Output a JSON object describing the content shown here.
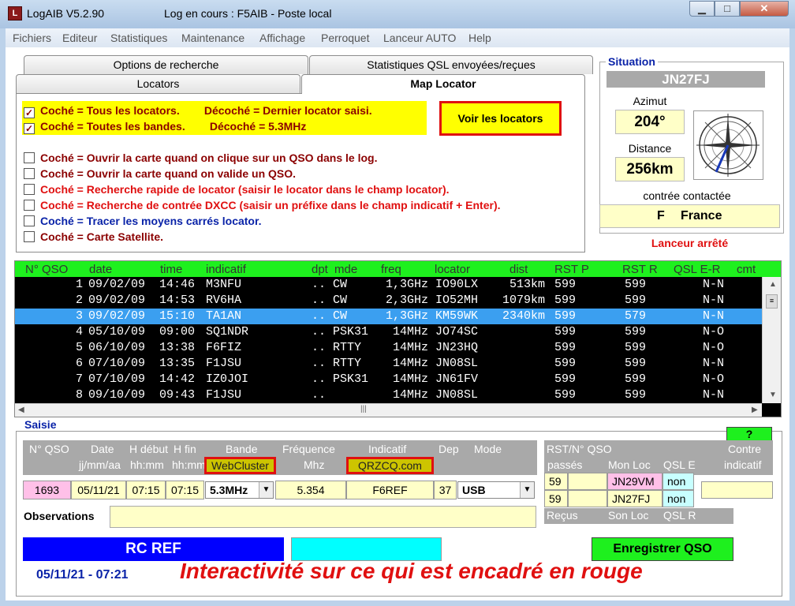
{
  "window": {
    "app_title": "LogAIB  V5.2.90",
    "log_status": "Log en cours : F5AIB - Poste local",
    "min": "▁",
    "max": "□",
    "close": "✕"
  },
  "menu": [
    "Fichiers",
    "Editeur",
    "Statistiques",
    "Maintenance",
    "Affichage",
    "Perroquet",
    "Lanceur AUTO",
    "Help"
  ],
  "tabs": {
    "back_left": "Options de recherche",
    "back_right": "Statistiques QSL envoyées/reçues",
    "front_left": "Locators",
    "active": "Map Locator"
  },
  "map_options": [
    {
      "checked": true,
      "text": "Coché = Tous les locators.        Décoché = Dernier locator saisi.",
      "color": "dark"
    },
    {
      "checked": true,
      "text": "Coché = Toutes les bandes.        Décoché = 5.3MHz",
      "color": "dark"
    },
    {
      "checked": false,
      "text": "Coché = Ouvrir la carte quand on clique sur un QSO dans le log.",
      "color": "dark"
    },
    {
      "checked": false,
      "text": "Coché = Ouvrir la carte quand on valide un QSO.",
      "color": "dark"
    },
    {
      "checked": false,
      "text": "Coché = Recherche rapide de locator (saisir le locator dans le champ locator).",
      "color": "red"
    },
    {
      "checked": false,
      "text": "Coché = Recherche de contrée DXCC (saisir un préfixe dans le champ indicatif + Enter).",
      "color": "red"
    },
    {
      "checked": false,
      "text": "Coché = Tracer les moyens carrés locator.",
      "color": "blue"
    },
    {
      "checked": false,
      "text": "Coché = Carte Satellite.",
      "color": "dark"
    }
  ],
  "voir_button": "Voir les locators",
  "situation": {
    "title": "Situation",
    "locator": "JN27FJ",
    "azimut_label": "Azimut",
    "azimut_value": "204°",
    "distance_label": "Distance",
    "distance_value": "256km",
    "contree_label": "contrée contactée",
    "prefix": "F",
    "country": "France",
    "launcher_status": "Lanceur arrêté"
  },
  "log_table": {
    "headers": [
      "N° QSO",
      "date",
      "time",
      "indicatif",
      "dpt",
      "mde",
      "freq",
      "locator",
      "dist",
      "RST P",
      "RST R",
      "QSL E-R",
      "cmt"
    ],
    "selected_row": 2,
    "rows": [
      [
        "1",
        "09/02/09",
        "14:46",
        "M3NFU",
        "..",
        "CW",
        "1,3GHz",
        "IO90LX",
        "513km",
        "599",
        "599",
        "N-N"
      ],
      [
        "2",
        "09/02/09",
        "14:53",
        "RV6HA",
        "..",
        "CW",
        "2,3GHz",
        "IO52MH",
        "1079km",
        "599",
        "599",
        "N-N"
      ],
      [
        "3",
        "09/02/09",
        "15:10",
        "TA1AN",
        "..",
        "CW",
        "1,3GHz",
        "KM59WK",
        "2340km",
        "599",
        "579",
        "N-N"
      ],
      [
        "4",
        "05/10/09",
        "09:00",
        "SQ1NDR",
        "..",
        "PSK31",
        "14MHz",
        "JO74SC",
        "",
        "599",
        "599",
        "N-O"
      ],
      [
        "5",
        "06/10/09",
        "13:38",
        "F6FIZ",
        "..",
        "RTTY",
        "14MHz",
        "JN23HQ",
        "",
        "599",
        "599",
        "N-O"
      ],
      [
        "6",
        "07/10/09",
        "13:35",
        "F1JSU",
        "..",
        "RTTY",
        "14MHz",
        "JN08SL",
        "",
        "599",
        "599",
        "N-N"
      ],
      [
        "7",
        "07/10/09",
        "14:42",
        "IZ0JOI",
        "..",
        "PSK31",
        "14MHz",
        "JN61FV",
        "",
        "599",
        "599",
        "N-O"
      ],
      [
        "8",
        "09/10/09",
        "09:43",
        "F1JSU",
        "..",
        "",
        "14MHz",
        "JN08SL",
        "",
        "599",
        "599",
        "N-N"
      ]
    ]
  },
  "saisie": {
    "title": "Saisie",
    "help": "?",
    "labels": {
      "qso": "N° QSO",
      "date": "Date",
      "date_fmt": "jj/mm/aa",
      "hdebut": "H début",
      "hdebut_fmt": "hh:mm",
      "hfin": "H fin",
      "hfin_fmt": "hh:mm",
      "bande": "Bande",
      "freq": "Fréquence",
      "freq_unit": "Mhz",
      "indicatif": "Indicatif",
      "dep": "Dep",
      "mode": "Mode",
      "rst": "RST/N° QSO",
      "passes": "passés",
      "monloc": "Mon Loc",
      "qsle": "QSL E",
      "contre": "Contre",
      "contre_ind": "indicatif",
      "recus": "Reçus",
      "sonloc": "Son Loc",
      "qslr": "QSL R"
    },
    "webcluster": "WebCluster",
    "qrzcq": "QRZCQ.com",
    "values": {
      "qso": "1693",
      "date": "05/11/21",
      "hdebut": "07:15",
      "hfin": "07:15",
      "bande": "5.3MHz",
      "freq": "5.354",
      "indicatif": "F6REF",
      "dep": "37",
      "mode": "USB",
      "rst_sent": "59",
      "rst_rcvd": "59",
      "my_loc": "JN29VM",
      "his_loc": "JN27FJ",
      "qsl_e": "non",
      "qsl_r": "non"
    },
    "observations_label": "Observations",
    "club": "RC REF",
    "save_button": "Enregistrer QSO",
    "datetime": "05/11/21 - 07:21",
    "notice": "Interactivité sur ce qui est encadré en rouge"
  }
}
